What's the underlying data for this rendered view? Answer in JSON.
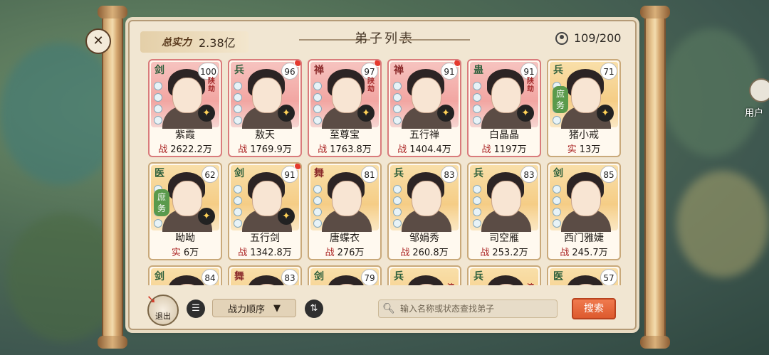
{
  "header": {
    "power_label": "总实力",
    "power_value": "2.38亿",
    "title": "弟子列表",
    "count": "109/200"
  },
  "cards": [
    {
      "type": "剑",
      "level": "100",
      "name": "紫霞",
      "stat_key": "战",
      "stat_value": "2622.2万",
      "theme": "red",
      "fate": "陕劫",
      "star": true,
      "dot": false
    },
    {
      "type": "兵",
      "level": "96",
      "name": "敖天",
      "stat_key": "战",
      "stat_value": "1769.9万",
      "theme": "red",
      "fate": "",
      "star": true,
      "dot": true
    },
    {
      "type": "禅",
      "level": "97",
      "name": "至尊宝",
      "stat_key": "战",
      "stat_value": "1763.8万",
      "theme": "red",
      "fate": "陕劫",
      "star": true,
      "dot": true
    },
    {
      "type": "禅",
      "level": "91",
      "name": "五行禅",
      "stat_key": "战",
      "stat_value": "1404.4万",
      "theme": "red",
      "fate": "",
      "star": true,
      "dot": true
    },
    {
      "type": "蛊",
      "level": "91",
      "name": "白晶晶",
      "stat_key": "战",
      "stat_value": "1197万",
      "theme": "red",
      "fate": "陕劫",
      "star": true,
      "dot": false
    },
    {
      "type": "兵",
      "level": "71",
      "name": "猪小戒",
      "stat_key": "实",
      "stat_value": "13万",
      "theme": "gold",
      "fate": "",
      "star": true,
      "dot": false,
      "intern": "庶务"
    },
    {
      "type": "医",
      "level": "62",
      "name": "呦呦",
      "stat_key": "实",
      "stat_value": "6万",
      "theme": "gold",
      "fate": "",
      "star": true,
      "dot": false,
      "intern": "庶务"
    },
    {
      "type": "剑",
      "level": "91",
      "name": "五行剑",
      "stat_key": "战",
      "stat_value": "1342.8万",
      "theme": "gold",
      "fate": "",
      "star": true,
      "dot": true
    },
    {
      "type": "舞",
      "level": "81",
      "name": "唐蝶衣",
      "stat_key": "战",
      "stat_value": "276万",
      "theme": "gold",
      "fate": "",
      "star": false,
      "dot": false
    },
    {
      "type": "兵",
      "level": "83",
      "name": "邹娟秀",
      "stat_key": "战",
      "stat_value": "260.8万",
      "theme": "gold",
      "fate": "",
      "star": false,
      "dot": false
    },
    {
      "type": "兵",
      "level": "83",
      "name": "司空雁",
      "stat_key": "战",
      "stat_value": "253.2万",
      "theme": "gold",
      "fate": "",
      "star": false,
      "dot": false
    },
    {
      "type": "剑",
      "level": "85",
      "name": "西门雅婕",
      "stat_key": "战",
      "stat_value": "245.7万",
      "theme": "gold",
      "fate": "",
      "star": false,
      "dot": false
    },
    {
      "type": "剑",
      "level": "84",
      "name": "",
      "stat_key": "",
      "stat_value": "",
      "theme": "gold",
      "fate": "",
      "star": false,
      "dot": false
    },
    {
      "type": "舞",
      "level": "83",
      "name": "",
      "stat_key": "",
      "stat_value": "",
      "theme": "gold",
      "fate": "",
      "star": false,
      "dot": false
    },
    {
      "type": "剑",
      "level": "79",
      "name": "",
      "stat_key": "",
      "stat_value": "",
      "theme": "gold",
      "fate": "",
      "star": false,
      "dot": false
    },
    {
      "type": "兵",
      "level": "",
      "name": "",
      "stat_key": "",
      "stat_value": "",
      "theme": "gold",
      "fate": "渡劫",
      "star": false,
      "dot": false
    },
    {
      "type": "兵",
      "level": "",
      "name": "",
      "stat_key": "",
      "stat_value": "",
      "theme": "gold",
      "fate": "渡劫",
      "star": false,
      "dot": false
    },
    {
      "type": "医",
      "level": "57",
      "name": "",
      "stat_key": "",
      "stat_value": "",
      "theme": "gold",
      "fate": "",
      "star": false,
      "dot": false
    }
  ],
  "footer": {
    "exit_label": "退出",
    "sort_label": "战力顺序",
    "search_placeholder": "输入名称或状态查找弟子",
    "search_button": "搜索"
  },
  "side": {
    "user_center": "用户"
  }
}
